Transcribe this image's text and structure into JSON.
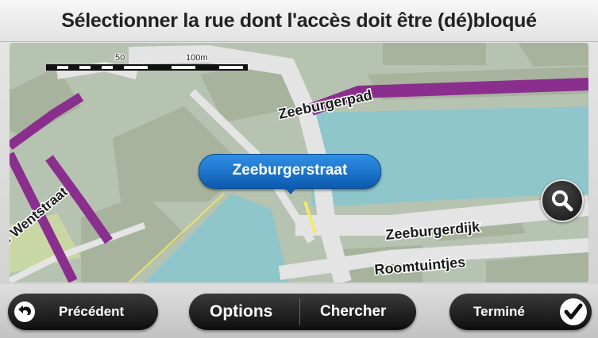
{
  "header": {
    "title": "Sélectionner la rue dont l'accès doit être (dé)bloqué"
  },
  "map": {
    "scale_labels": [
      "50",
      "100m"
    ],
    "streets": {
      "zeeburgerpad": "Zeeburgerpad",
      "wentstraat": "e Wentstraat",
      "zeeburgerdijk": "Zeeburgerdijk",
      "roomtuintjes": "Roomtuintjes"
    },
    "selected_street": "Zeeburgerstraat",
    "colors": {
      "water": "#8fc6cc",
      "land": "#b7c3b1",
      "road": "#e4e4e4",
      "major_road": "#8b2f8e",
      "building": "#a7b39d"
    }
  },
  "zoom_button": {
    "icon": "search-icon"
  },
  "toolbar": {
    "back_label": "Précédent",
    "back_icon": "back-arrow-icon",
    "options_label": "Options",
    "search_label": "Chercher",
    "done_label": "Terminé",
    "done_icon": "checkmark-icon"
  }
}
